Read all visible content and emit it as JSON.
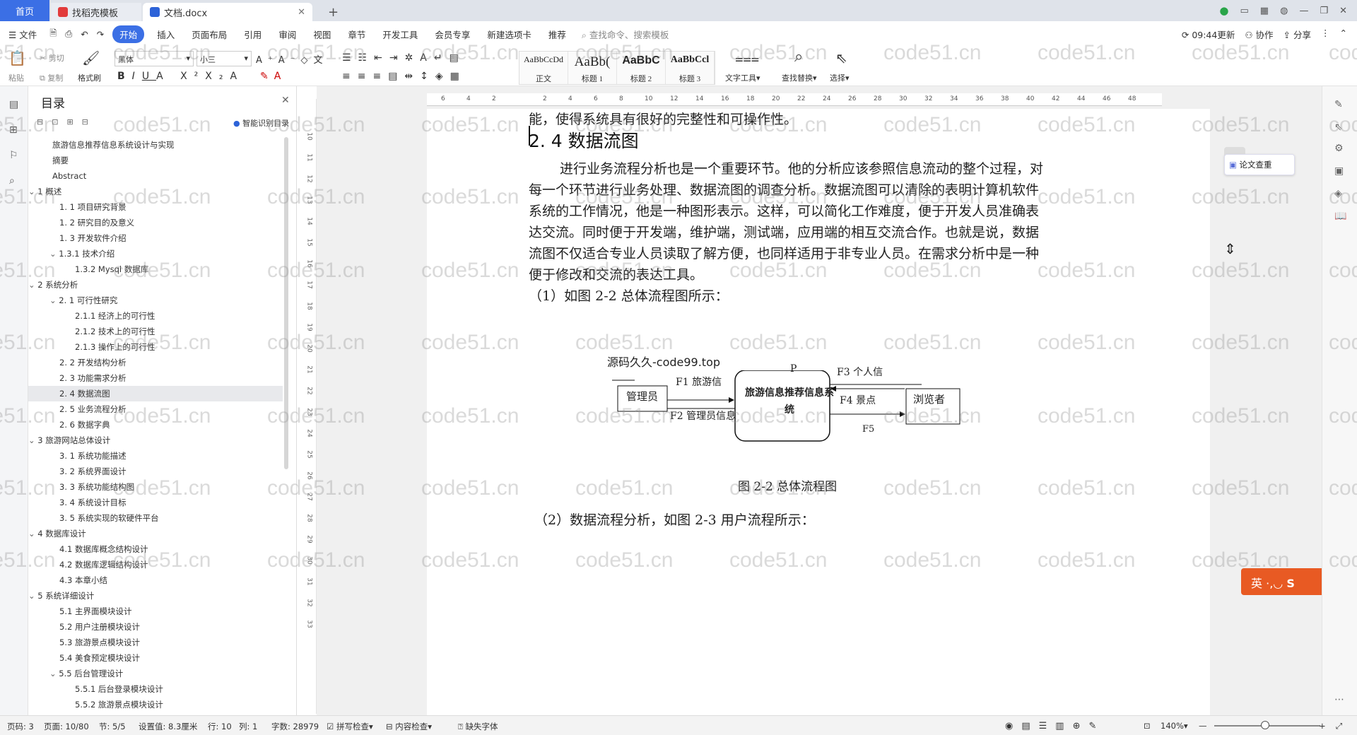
{
  "tabs": {
    "home": "首页",
    "template": "找稻壳模板",
    "doc": "文档.docx",
    "new_tab": "+"
  },
  "menu": {
    "file": "文件",
    "items": [
      "开始",
      "插入",
      "页面布局",
      "引用",
      "审阅",
      "视图",
      "章节",
      "开发工具",
      "会员专享",
      "新建选项卡",
      "推荐"
    ],
    "active": "开始",
    "search": "查找命令、搜索模板",
    "time_update": "09:44更新",
    "collab": "协作",
    "share": "分享"
  },
  "ribbon": {
    "paste": "粘贴",
    "cut": "剪切",
    "copy": "复制",
    "format_painter": "格式刷",
    "font_name": "黑体",
    "font_size": "小三",
    "styles": [
      {
        "preview": "AaBbCcDd",
        "name": "正文"
      },
      {
        "preview": "AaBb(",
        "name": "标题 1"
      },
      {
        "preview": "AaBbC",
        "name": "标题 2"
      },
      {
        "preview": "AaBbCcl",
        "name": "标题 3"
      }
    ],
    "text_tool": "文字工具",
    "find_replace": "查找替换",
    "select": "选择"
  },
  "nav": {
    "title": "目录",
    "smart_toc": "智能识别目录",
    "items": [
      {
        "label": "旅游信息推荐信息系统设计与实现",
        "level": 0
      },
      {
        "label": "摘要",
        "level": 0
      },
      {
        "label": "Abstract",
        "level": 0
      },
      {
        "label": "1  概述",
        "level": 1,
        "caret": "v"
      },
      {
        "label": "1. 1 项目研究背景",
        "level": 2
      },
      {
        "label": "1. 2 研究目的及意义",
        "level": 2
      },
      {
        "label": "1. 3 开发软件介绍",
        "level": 2
      },
      {
        "label": "1.3.1 技术介绍",
        "level": 2,
        "caret": "v"
      },
      {
        "label": "1.3.2 Mysql 数据库",
        "level": 3
      },
      {
        "label": "2  系统分析",
        "level": 1,
        "caret": "v"
      },
      {
        "label": "2. 1 可行性研究",
        "level": 2,
        "caret": "v"
      },
      {
        "label": "2.1.1 经济上的可行性",
        "level": 3
      },
      {
        "label": "2.1.2 技术上的可行性",
        "level": 3
      },
      {
        "label": "2.1.3 操作上的可行性",
        "level": 3
      },
      {
        "label": "2. 2 开发结构分析",
        "level": 2
      },
      {
        "label": "2. 3 功能需求分析",
        "level": 2
      },
      {
        "label": "2. 4 数据流图",
        "level": 2,
        "selected": true
      },
      {
        "label": "2. 5 业务流程分析",
        "level": 2
      },
      {
        "label": "2. 6 数据字典",
        "level": 2
      },
      {
        "label": "3  旅游网站总体设计",
        "level": 1,
        "caret": "v"
      },
      {
        "label": "3. 1 系统功能描述",
        "level": 2
      },
      {
        "label": "3. 2 系统界面设计",
        "level": 2
      },
      {
        "label": "3. 3 系统功能结构图",
        "level": 2
      },
      {
        "label": "3. 4 系统设计目标",
        "level": 2
      },
      {
        "label": "3. 5 系统实现的软硬件平台",
        "level": 2
      },
      {
        "label": "4  数据库设计",
        "level": 1,
        "caret": "v"
      },
      {
        "label": "4.1 数据库概念结构设计",
        "level": 2
      },
      {
        "label": "4.2 数据库逻辑结构设计",
        "level": 2
      },
      {
        "label": "4.3 本章小结",
        "level": 2
      },
      {
        "label": "5  系统详细设计",
        "level": 1,
        "caret": "v"
      },
      {
        "label": "5.1 主界面模块设计",
        "level": 2
      },
      {
        "label": "5.2 用户注册模块设计",
        "level": 2
      },
      {
        "label": "5.3 旅游景点模块设计",
        "level": 2
      },
      {
        "label": "5.4 美食预定模块设计",
        "level": 2
      },
      {
        "label": "5.5 后台管理设计",
        "level": 2,
        "caret": "v"
      },
      {
        "label": "5.5.1 后台登录模块设计",
        "level": 3
      },
      {
        "label": "5.5.2 旅游景点模块设计",
        "level": 3
      }
    ]
  },
  "ruler": {
    "h_ticks": [
      "6",
      "4",
      "2",
      "",
      "2",
      "4",
      "6",
      "8",
      "10",
      "12",
      "14",
      "16",
      "18",
      "20",
      "22",
      "24",
      "26",
      "28",
      "30",
      "32",
      "34",
      "36",
      "38",
      "40",
      "42",
      "44",
      "46",
      "48"
    ],
    "v_ticks": [
      "10",
      "11",
      "12",
      "13",
      "14",
      "15",
      "16",
      "17",
      "18",
      "19",
      "20",
      "21",
      "22",
      "23",
      "24",
      "25",
      "26",
      "27",
      "28",
      "29",
      "30",
      "31",
      "32",
      "33"
    ]
  },
  "doc": {
    "top_cut": "能，使得系统具有很好的完整性和可操作性。",
    "heading": "2. 4 数据流图",
    "para": [
      "进行业务流程分析也是一个重要环节。他的分析应该参照信息流动的整个过程，对",
      "每一个环节进行业务处理、数据流图的调查分析。数据流图可以清除的表明计算机软件",
      "系统的工作情况，他是一种图形表示。这样，可以简化工作难度，便于开发人员准确表",
      "达交流。同时便于开发端，维护端，测试端，应用端的相互交流合作。也就是说，数据",
      "流图不仅适合专业人员读取了解方便，也同样适用于非专业人员。在需求分析中是一种",
      "便于修改和交流的表达工具。"
    ],
    "line1": "（1）如图 2-2 总体流程图所示：",
    "diagram": {
      "watermark_text": "源码久久-code99.top",
      "admin": "管理员",
      "system_p": "P",
      "system": "旅游信息推荐信息系统",
      "viewer": "浏览者",
      "f1": "F1 旅游信",
      "f2": "F2 管理员信息",
      "f3": "F3 个人信",
      "f4": "F4 景点",
      "f5": "F5"
    },
    "caption": "图 2-2  总体流程图",
    "line2": "（2）数据流程分析，如图 2-3 用户流程所示："
  },
  "side": {
    "check_paper": "论文查重",
    "ime": "英"
  },
  "status": {
    "pages": "页码: 3",
    "page": "页面: 10/80",
    "section": "节: 5/5",
    "setting": "设置值: 8.3厘米",
    "row": "行: 10",
    "col": "列: 1",
    "words": "字数: 28979",
    "spell": "拼写检查",
    "content_check": "内容检查",
    "missing_font": "缺失字体",
    "zoom": "140%"
  },
  "watermark": "code51.cn"
}
